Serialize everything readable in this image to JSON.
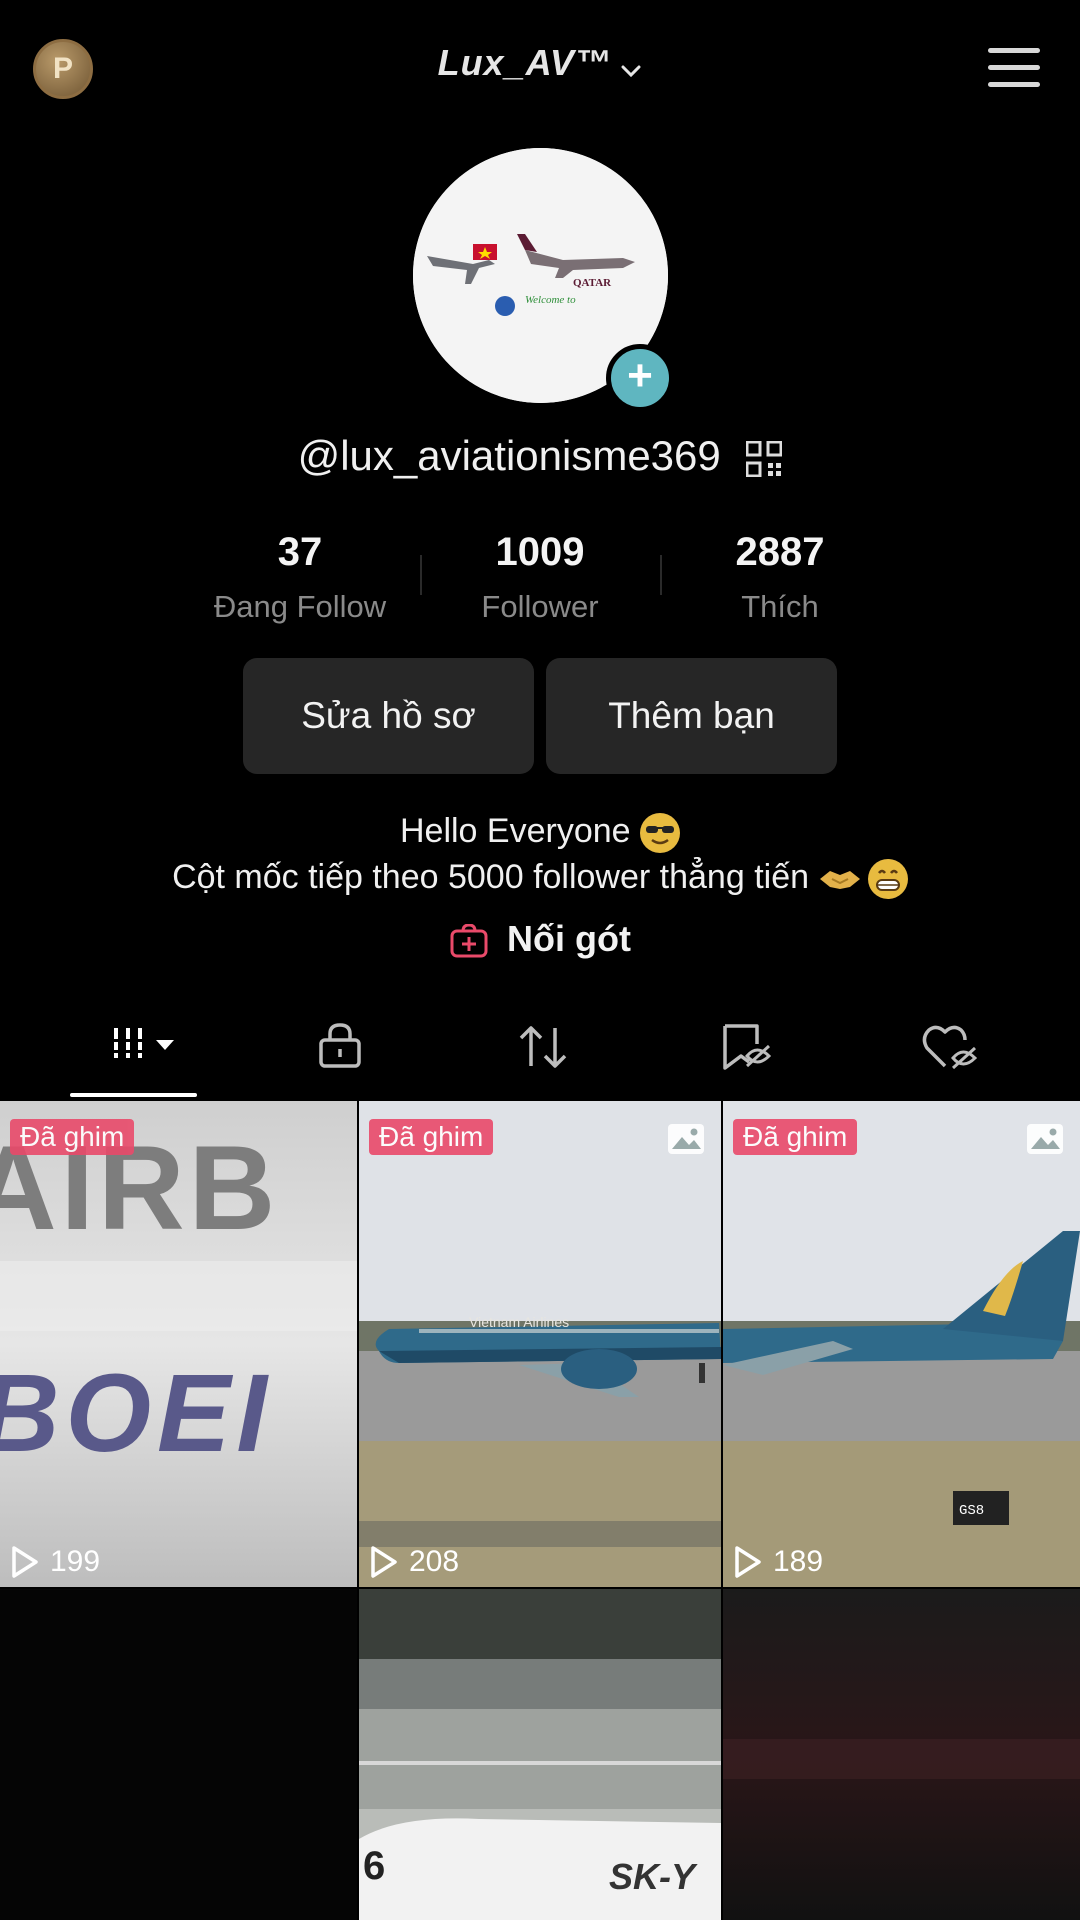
{
  "header": {
    "coin_label": "P",
    "title": "Lux_AV™"
  },
  "profile": {
    "username": "@lux_aviationisme369",
    "stats": [
      {
        "value": "37",
        "label": "Đang Follow"
      },
      {
        "value": "1009",
        "label": "Follower"
      },
      {
        "value": "2887",
        "label": "Thích"
      }
    ],
    "edit_button": "Sửa hồ sơ",
    "add_friend_button": "Thêm bạn",
    "bio_line1": "Hello Everyone",
    "bio_line2": "Cột mốc tiếp theo 5000 follower thẳng tiến",
    "shop_label": "Nối gót"
  },
  "tabs": [
    {
      "icon": "grid-icon"
    },
    {
      "icon": "lock-icon"
    },
    {
      "icon": "repost-icon"
    },
    {
      "icon": "bookmark-icon"
    },
    {
      "icon": "liked-icon"
    }
  ],
  "videos": [
    {
      "pinned": "Đã ghim",
      "views": "199"
    },
    {
      "pinned": "Đã ghim",
      "views": "208",
      "photo": true
    },
    {
      "pinned": "Đã ghim",
      "views": "189",
      "photo": true
    }
  ],
  "colors": {
    "background": "#000000",
    "button_bg": "#262626",
    "pinned_badge": "#e94a6a",
    "add_badge": "#5fb6c0"
  }
}
